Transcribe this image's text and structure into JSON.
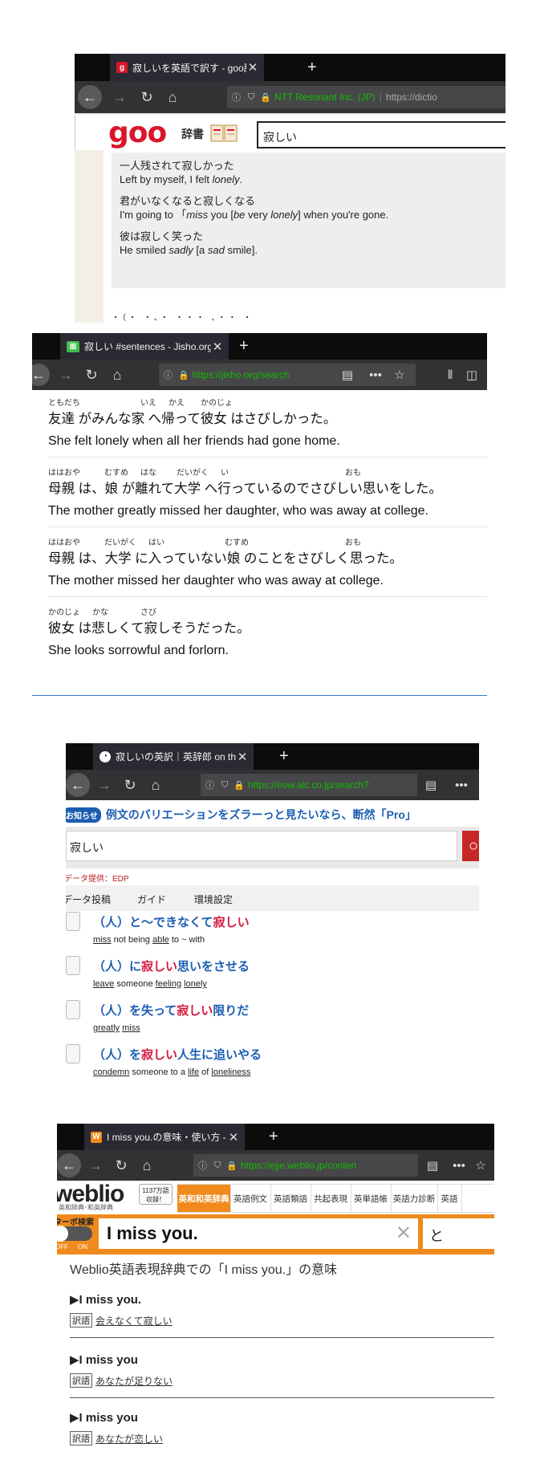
{
  "goo": {
    "tab_title": "寂しいを英語で訳す - goo辞書",
    "favicon": "g",
    "new_tab": "+",
    "url_org": "NTT Resonant Inc. (JP)",
    "url_text": "https://dictio",
    "logo": "goo",
    "logo_sub": "辞書",
    "search_value": "寂しい",
    "examples": [
      {
        "jp": "一人残されて寂しかった",
        "en_parts": [
          "Left by myself, I felt ",
          "lonely",
          "."
        ]
      },
      {
        "jp": "君がいなくなると寂しくなる",
        "en_parts": [
          "I'm going to 「",
          "miss",
          " you [",
          "be",
          " very ",
          "lonely",
          "] when you're gone."
        ]
      },
      {
        "jp": "彼は寂しく笑った",
        "en_parts": [
          "He smiled ",
          "sadly",
          " [a ",
          "sad",
          " smile]."
        ]
      }
    ]
  },
  "jisho": {
    "tab_title": "寂しい #sentences - Jisho.org",
    "new_tab": "+",
    "url_text": "https://jisho.org/search",
    "sentences": [
      {
        "furigana": [
          "ともだち",
          "いえ",
          "かえ",
          "かのじょ"
        ],
        "jp": "友達 がみんな家 へ帰って彼女 はさびしかった。",
        "en": "She felt lonely when all her friends had gone home."
      },
      {
        "furigana": [
          "ははおや",
          "むすめ",
          "はな",
          "だいがく",
          "い",
          "おも"
        ],
        "jp": "母親 は、娘 が離れて大学 へ行っているのでさびしい思いをした。",
        "en": "The mother greatly missed her daughter, who was away at college."
      },
      {
        "furigana": [
          "ははおや",
          "だいがく",
          "はい",
          "むすめ",
          "おも"
        ],
        "jp": "母親 は、大学 に入っていない娘 のことをさびしく思った。",
        "en": "The mother missed her daughter who was away at college."
      },
      {
        "furigana": [
          "かのじょ",
          "かな",
          "さび"
        ],
        "jp": "彼女 は悲しくて寂しそうだった。",
        "en": "She looks sorrowful and forlorn."
      }
    ]
  },
  "alc": {
    "tab_title": "寂しいの英訳｜英辞郎 on the WEB",
    "new_tab": "+",
    "url_text": "https://eow.alc.co.jp/search?",
    "notice_badge": "お知らせ",
    "notice_text": "例文のバリエーションをズラーっと見たいなら、断然「Pro」",
    "search_value": "寂しい",
    "data_source": "データ提供：EDP",
    "nav": [
      "データ投稿",
      "ガイド",
      "環境設定"
    ],
    "entries": [
      {
        "h1": "（人）と～できなくて",
        "h2": "寂しい",
        "h3": "",
        "sub": [
          [
            "miss",
            true
          ],
          [
            " not being ",
            false
          ],
          [
            "able",
            true
          ],
          [
            " to ~ with",
            false
          ]
        ]
      },
      {
        "h1": "（人）に",
        "h2": "寂しい",
        "h3": "思いをさせる",
        "sub": [
          [
            "leave",
            true
          ],
          [
            " someone ",
            false
          ],
          [
            "feeling",
            true
          ],
          [
            " ",
            false
          ],
          [
            "lonely",
            true
          ]
        ]
      },
      {
        "h1": "（人）を失って",
        "h2": "寂しい",
        "h3": "限りだ",
        "sub": [
          [
            "greatly",
            true
          ],
          [
            " ",
            false
          ],
          [
            "miss",
            true
          ]
        ]
      },
      {
        "h1": "（人）を",
        "h2": "寂しい",
        "h3": "人生に追いやる",
        "sub": [
          [
            "condemn",
            true
          ],
          [
            " someone to a ",
            false
          ],
          [
            "life",
            true
          ],
          [
            " of ",
            false
          ],
          [
            "loneliness",
            true
          ]
        ]
      }
    ]
  },
  "weblio": {
    "tab_title": "I miss you.の意味・使い方 - 英",
    "favicon": "W",
    "new_tab": "+",
    "url_text": "https://ejje.weblio.jp/conten",
    "logo": "weblio",
    "logo_sub": "英和辞典･和英辞典",
    "count_badge_1": "1137万語",
    "count_badge_2": "収録！",
    "tabs": [
      "英和和英辞典",
      "英語例文",
      "英語類語",
      "共起表現",
      "英単語帳",
      "英語力診断",
      "英語"
    ],
    "turbo_label": "ターボ検索",
    "toggle_off": "OFF",
    "toggle_on": "ON",
    "search_value": "I miss you.",
    "search_btn_partial": "と",
    "heading": "Weblio英語表現辞典での「I miss you.」の意味",
    "entries": [
      {
        "head": "▶I miss you.",
        "tag": "訳語",
        "trans": "会えなくて寂しい"
      },
      {
        "head": "▶I miss you",
        "tag": "訳語",
        "trans": "あなたが足りない"
      },
      {
        "head": "▶I miss you",
        "tag": "訳語",
        "trans": "あなたが恋しい"
      }
    ]
  },
  "colors": {
    "goo_red": "#d9162b",
    "alc_blue": "#1c5db3",
    "alc_red": "#d5173b",
    "weblio_orange": "#f08a1c",
    "firefox_dark": "#0c0c0d",
    "lock_green": "#12bc00"
  }
}
